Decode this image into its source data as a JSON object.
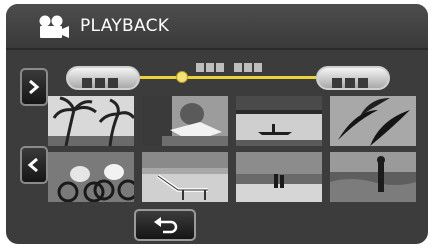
{
  "header": {
    "title": "PLAYBACK",
    "mode_icon": "movie-camera-icon"
  },
  "navigation": {
    "next_icon": "chevron-right-icon",
    "prev_icon": "chevron-left-icon",
    "back_icon": "return-arrow-icon"
  },
  "timeline": {
    "accent_color": "#e9d33b",
    "start_label_icon": "date-placeholder",
    "end_label_icon": "date-placeholder"
  },
  "thumbnails": [
    {
      "scene": "palm-trees"
    },
    {
      "scene": "person-reading"
    },
    {
      "scene": "canoe-on-lake"
    },
    {
      "scene": "palm-leaves"
    },
    {
      "scene": "cyclists"
    },
    {
      "scene": "beach-chair"
    },
    {
      "scene": "couple-on-beach"
    },
    {
      "scene": "person-by-water"
    }
  ]
}
